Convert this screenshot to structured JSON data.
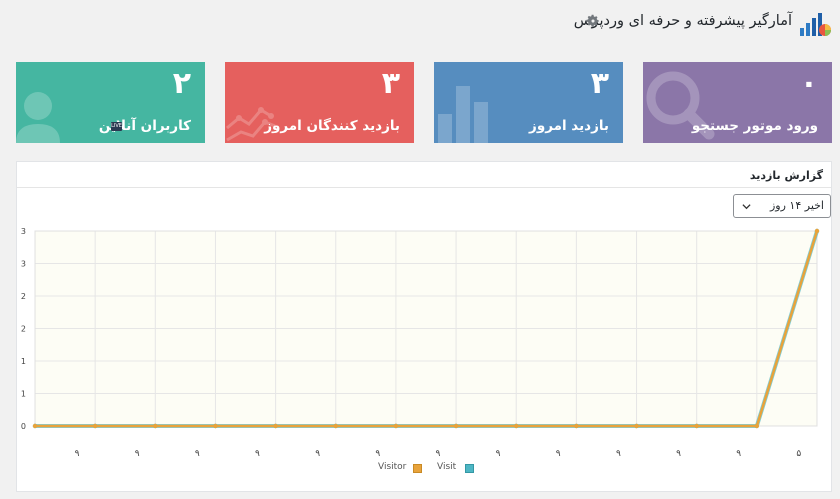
{
  "header": {
    "title": "آمارگیر پیشرفته و حرفه ای وردپرس",
    "logo_icon": "chart-logo-icon",
    "settings_icon": "gear-icon"
  },
  "tiles": [
    {
      "key": "search",
      "value": "۰",
      "label": "ورود موتور جستجو",
      "icon": "magnifier-icon",
      "color": "#8b76a8"
    },
    {
      "key": "visits",
      "value": "۳",
      "label": "بازدید امروز",
      "icon": "bar-chart-icon",
      "color": "#568dbf"
    },
    {
      "key": "visitors",
      "value": "۳",
      "label": "بازدید کنندگان امروز",
      "icon": "line-chart-icon",
      "color": "#e5605e"
    },
    {
      "key": "online",
      "value": "۲",
      "label": "کاربران آنلاین",
      "icon": "user-icon",
      "badge": "LIVE",
      "color": "#45b6a1"
    }
  ],
  "panel": {
    "title": "گزارش بازدید",
    "range_select": {
      "value": "اخیر ۱۴ روز",
      "options": [
        "اخیر ۱۴ روز"
      ]
    }
  },
  "chart_data": {
    "type": "line",
    "categories": [
      "۹",
      "۹",
      "۹",
      "۹",
      "۹",
      "۹",
      "۹",
      "۹",
      "۹",
      "۹",
      "۹",
      "۹",
      "۵",
      "۵"
    ],
    "series": [
      {
        "name": "Visitor",
        "values": [
          0,
          0,
          0,
          0,
          0,
          0,
          0,
          0,
          0,
          0,
          0,
          0,
          0,
          3
        ],
        "color": "#e8a33b"
      },
      {
        "name": "Visit",
        "values": [
          0,
          0,
          0,
          0,
          0,
          0,
          0,
          0,
          0,
          0,
          0,
          0,
          0,
          3
        ],
        "color": "#4db6c4"
      }
    ],
    "ytick_labels": [
      "0",
      "1",
      "1",
      "2",
      "2",
      "3",
      "3"
    ],
    "ytick_values": [
      0,
      0.5,
      1,
      1.5,
      2,
      2.5,
      3
    ],
    "ylim": [
      0,
      3
    ],
    "grid": true,
    "legend": "bottom"
  }
}
